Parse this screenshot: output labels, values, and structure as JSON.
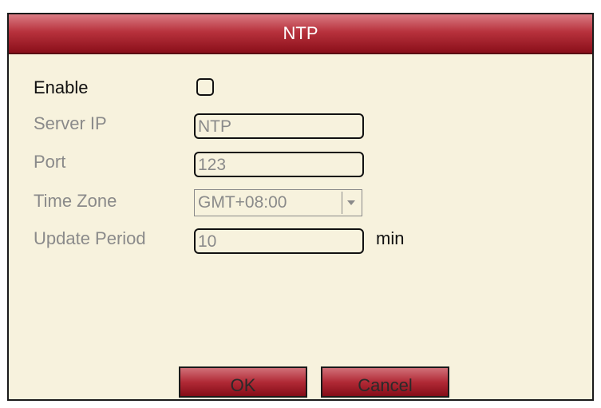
{
  "dialog": {
    "title": "NTP",
    "colors": {
      "title_bar": "#b8323d",
      "background": "#f7f2dd",
      "button": "#b12a36"
    }
  },
  "form": {
    "enable": {
      "label": "Enable",
      "checked": false
    },
    "server_ip": {
      "label": "Server IP",
      "value": "NTP"
    },
    "port": {
      "label": "Port",
      "value": "123"
    },
    "time_zone": {
      "label": "Time Zone",
      "value": "GMT+08:00"
    },
    "update_period": {
      "label": "Update Period",
      "value": "10",
      "unit": "min"
    }
  },
  "buttons": {
    "ok": "OK",
    "cancel": "Cancel"
  },
  "icons": {
    "dropdown": "chevron-down-icon",
    "checkbox": "checkbox-unchecked-icon"
  }
}
